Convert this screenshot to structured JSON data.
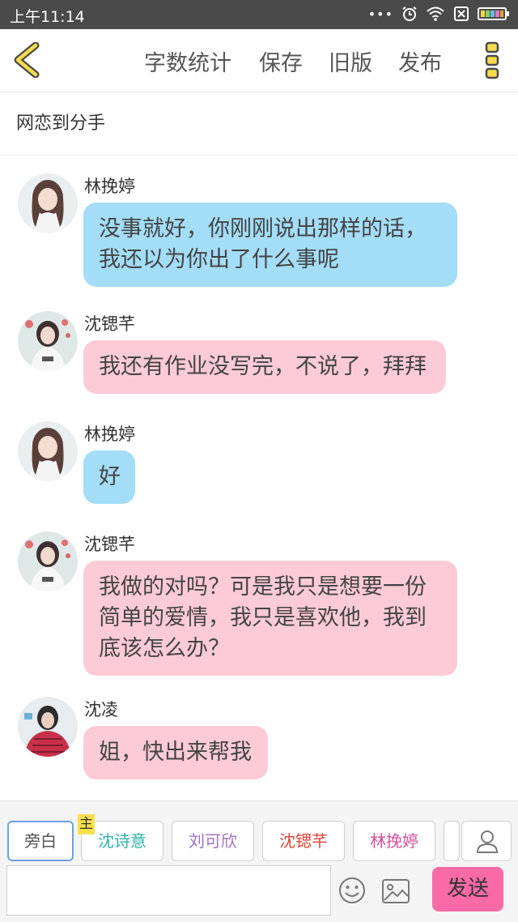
{
  "status_bar": {
    "time": "上午11:14"
  },
  "toolbar": {
    "word_count": "字数统计",
    "save": "保存",
    "old_version": "旧版",
    "publish": "发布"
  },
  "story": {
    "title": "网恋到分手"
  },
  "messages": [
    {
      "name": "林挽婷",
      "text": "没事就好，你刚刚说出那样的话，我还以为你出了什么事呢",
      "color": "#a3ddf8"
    },
    {
      "name": "沈锶芊",
      "text": "我还有作业没写完，不说了，拜拜",
      "color": "#fccbd6"
    },
    {
      "name": "林挽婷",
      "text": "好",
      "color": "#a3ddf8"
    },
    {
      "name": "沈锶芊",
      "text": "我做的对吗？可是我只是想要一份简单的爱情，我只是喜欢他，我到底该怎么办？",
      "color": "#fccbd6"
    },
    {
      "name": "沈凌",
      "text": "姐，快出来帮我",
      "color": "#fccbd6"
    }
  ],
  "roles": [
    {
      "label": "旁白",
      "color": "#555555",
      "active": true
    },
    {
      "label": "沈诗意",
      "color": "#2bb5a6"
    },
    {
      "label": "刘可欣",
      "color": "#a071c9"
    },
    {
      "label": "沈锶芊",
      "color": "#e0473a"
    },
    {
      "label": "林挽婷",
      "color": "#d64f9b"
    }
  ],
  "host_badge": "主",
  "composer": {
    "placeholder": "",
    "send_label": "发送"
  },
  "icons": {
    "back": "back-arrow-icon",
    "menu": "more-menu-icon",
    "emoji": "emoji-icon",
    "image": "image-icon",
    "profile": "user-icon"
  }
}
